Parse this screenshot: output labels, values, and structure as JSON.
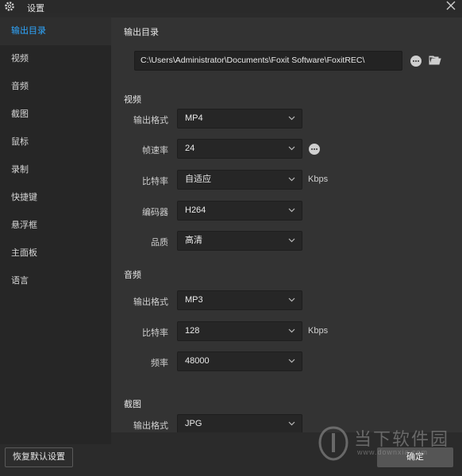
{
  "window": {
    "title": "设置"
  },
  "sidebar": {
    "items": [
      {
        "label": "输出目录",
        "active": true
      },
      {
        "label": "视频"
      },
      {
        "label": "音频"
      },
      {
        "label": "截图"
      },
      {
        "label": "鼠标"
      },
      {
        "label": "录制"
      },
      {
        "label": "快捷键"
      },
      {
        "label": "悬浮框"
      },
      {
        "label": "主面板"
      },
      {
        "label": "语言"
      }
    ]
  },
  "output_dir": {
    "title": "输出目录",
    "path": "C:\\Users\\Administrator\\Documents\\Foxit Software\\FoxitREC\\"
  },
  "video": {
    "title": "视频",
    "format": {
      "label": "输出格式",
      "value": "MP4"
    },
    "framerate": {
      "label": "帧速率",
      "value": "24"
    },
    "bitrate": {
      "label": "比特率",
      "value": "自适应",
      "unit": "Kbps"
    },
    "encoder": {
      "label": "编码器",
      "value": "H264"
    },
    "quality": {
      "label": "品质",
      "value": "高清"
    }
  },
  "audio": {
    "title": "音频",
    "format": {
      "label": "输出格式",
      "value": "MP3"
    },
    "bitrate": {
      "label": "比特率",
      "value": "128",
      "unit": "Kbps"
    },
    "frequency": {
      "label": "频率",
      "value": "48000"
    }
  },
  "screenshot": {
    "title": "截图",
    "format": {
      "label": "输出格式",
      "value": "JPG"
    }
  },
  "footer": {
    "reset_label": "恢复默认设置",
    "ok_label": "确定"
  },
  "watermark": {
    "text": "当下软件园",
    "url": "www.downxia.com"
  },
  "colors": {
    "accent": "#2ea7ff",
    "background": "#333333",
    "sidebar": "#262626"
  }
}
